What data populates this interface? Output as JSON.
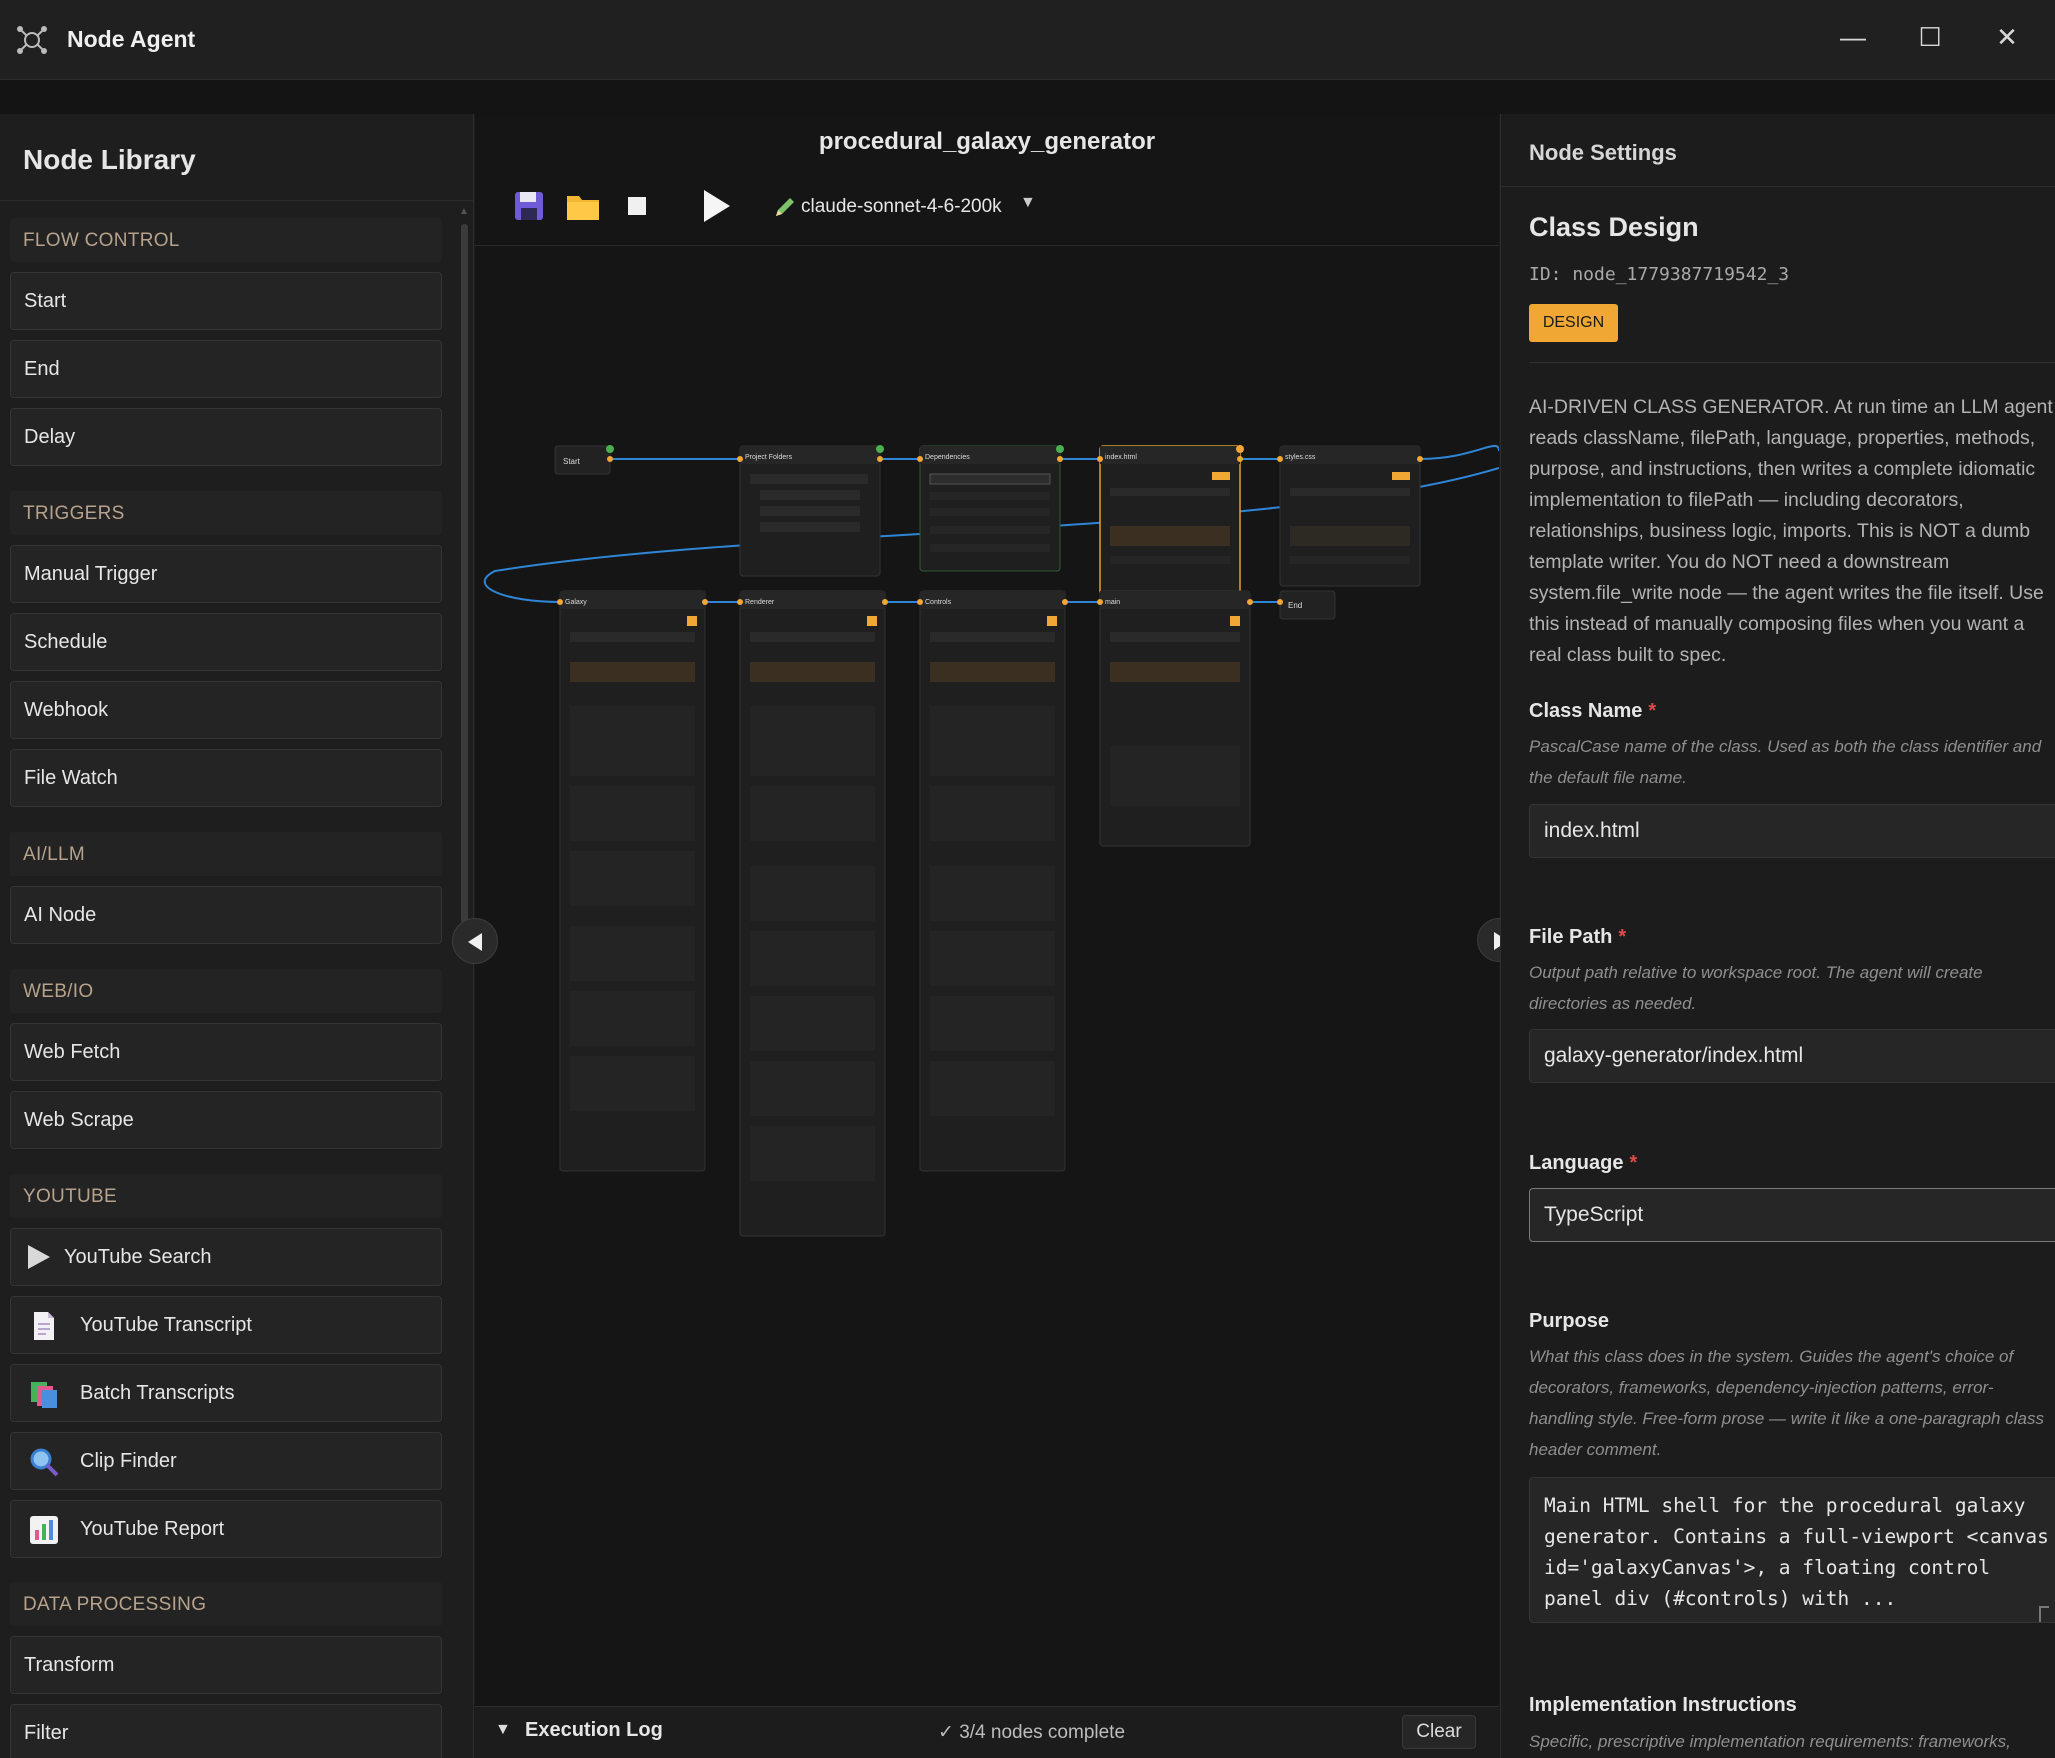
{
  "window": {
    "title": "Node Agent",
    "controls": {
      "minimize": "—",
      "maximize": "☐",
      "close": "✕"
    }
  },
  "library": {
    "title": "Node Library",
    "categories": [
      {
        "label": "FLOW CONTROL",
        "items": [
          {
            "label": "Start"
          },
          {
            "label": "End"
          },
          {
            "label": "Delay"
          }
        ]
      },
      {
        "label": "TRIGGERS",
        "items": [
          {
            "label": "Manual Trigger"
          },
          {
            "label": "Schedule"
          },
          {
            "label": "Webhook"
          },
          {
            "label": "File Watch"
          }
        ]
      },
      {
        "label": "AI/LLM",
        "items": [
          {
            "label": "AI Node"
          }
        ]
      },
      {
        "label": "WEB/IO",
        "items": [
          {
            "label": "Web Fetch"
          },
          {
            "label": "Web Scrape"
          }
        ]
      },
      {
        "label": "YOUTUBE",
        "items": [
          {
            "label": "YouTube Search",
            "icon": "play-icon"
          },
          {
            "label": "YouTube Transcript",
            "icon": "document-icon"
          },
          {
            "label": "Batch Transcripts",
            "icon": "stack-icon"
          },
          {
            "label": "Clip Finder",
            "icon": "magnifier-icon"
          },
          {
            "label": "YouTube Report",
            "icon": "bar-chart-icon"
          }
        ]
      },
      {
        "label": "DATA PROCESSING",
        "items": [
          {
            "label": "Transform"
          },
          {
            "label": "Filter"
          }
        ]
      }
    ]
  },
  "canvas": {
    "flow_name": "procedural_galaxy_generator",
    "toolbar": {
      "save": "floppy-disk-icon",
      "open": "folder-icon",
      "stop": "stop-icon",
      "run": "play-icon",
      "model": "claude-sonnet-4-6-200k",
      "model_caret": "▼"
    },
    "nodes_top": [
      {
        "title": "Start"
      },
      {
        "title": "Project Folders"
      },
      {
        "title": "Dependencies"
      },
      {
        "title": "index.html"
      },
      {
        "title": "styles.css"
      }
    ],
    "nodes_bottom": [
      {
        "title": "Galaxy"
      },
      {
        "title": "Renderer"
      },
      {
        "title": "Controls"
      },
      {
        "title": "main"
      },
      {
        "title": "End"
      }
    ],
    "colors": {
      "edge": "#2f86d6",
      "port": "#f0a733",
      "done": "#4caf50",
      "selected": "#e0a030"
    },
    "exec_log": {
      "arrow": "▼",
      "label": "Execution Log",
      "status": "✓ 3/4 nodes complete",
      "clear": "Clear"
    }
  },
  "settings": {
    "title": "Node Settings",
    "node_name": "Class Design",
    "node_id": "ID: node_1779387719542_3",
    "badge": "DESIGN",
    "description": "AI-DRIVEN CLASS GENERATOR. At run time an LLM agent reads className, filePath, language, properties, methods, purpose, and instructions, then writes a complete idiomatic implementation to filePath — including decorators, relationships, business logic, imports. This is NOT a dumb template writer. You do NOT need a downstream system.file_write node — the agent writes the file itself. Use this instead of manually composing files when you want a real class built to spec.",
    "fields": {
      "class_name": {
        "label": "Class Name",
        "required": "*",
        "help": "PascalCase name of the class. Used as both the class identifier and the default file name.",
        "value": "index.html"
      },
      "file_path": {
        "label": "File Path",
        "required": "*",
        "help": "Output path relative to workspace root. The agent will create directories as needed.",
        "value": "galaxy-generator/index.html"
      },
      "language": {
        "label": "Language",
        "required": "*",
        "value": "TypeScript"
      },
      "purpose": {
        "label": "Purpose",
        "help": "What this class does in the system. Guides the agent's choice of decorators, frameworks, dependency-injection patterns, error-handling style. Free-form prose — write it like a one-paragraph class header comment.",
        "value": "Main HTML shell for the procedural galaxy generator. Contains a full-viewport <canvas id='galaxyCanvas'>, a floating control panel div (#controls) with ..."
      },
      "implementation": {
        "label": "Implementation Instructions",
        "help": "Specific, prescriptive implementation requirements: frameworks,"
      }
    }
  }
}
